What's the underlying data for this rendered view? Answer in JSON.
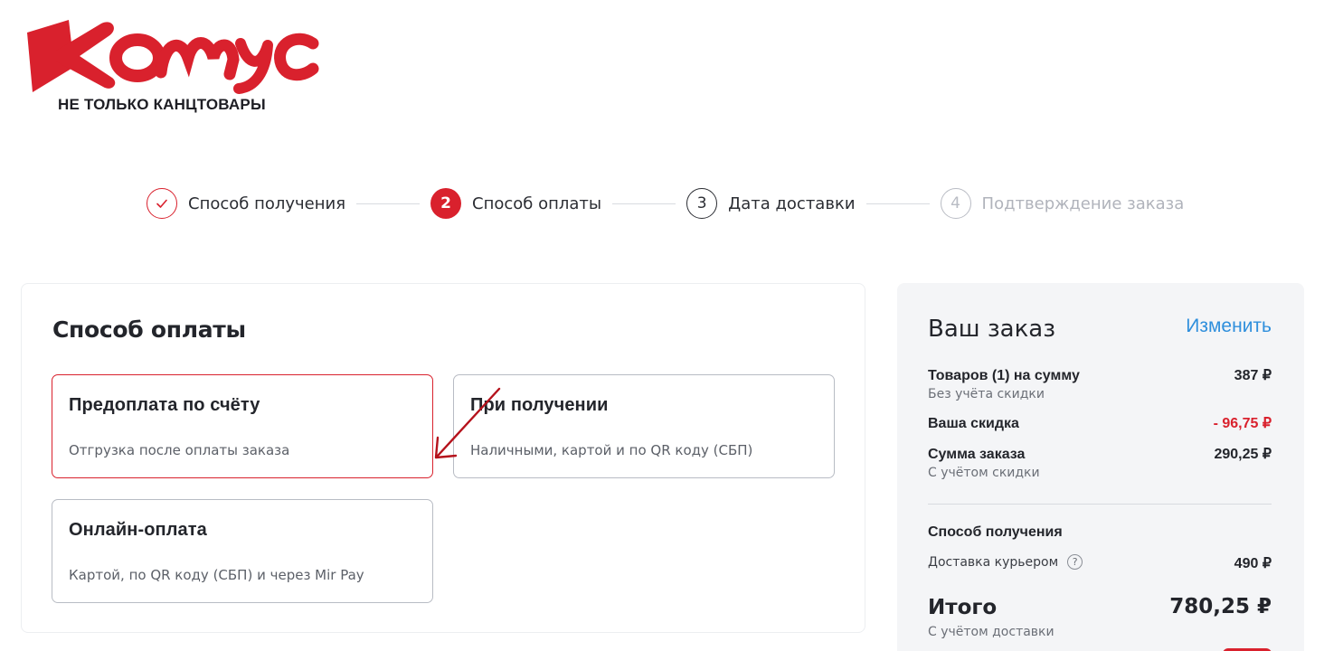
{
  "brand": {
    "logo_text": "Комус",
    "tagline": "НЕ ТОЛЬКО КАНЦТОВАРЫ",
    "color": "#d9212d"
  },
  "stepper": {
    "steps": [
      {
        "number": "",
        "label": "Способ получения",
        "state": "done",
        "icon": "check-icon"
      },
      {
        "number": "2",
        "label": "Способ оплаты",
        "state": "active"
      },
      {
        "number": "3",
        "label": "Дата доставки",
        "state": "todo"
      },
      {
        "number": "4",
        "label": "Подтверждение заказа",
        "state": "disabled"
      }
    ]
  },
  "payment": {
    "title": "Способ оплаты",
    "options": [
      {
        "title": "Предоплата по счёту",
        "subtitle": "Отгрузка после оплаты заказа",
        "selected": true
      },
      {
        "title": "При получении",
        "subtitle": "Наличными, картой и по QR коду (СБП)",
        "selected": false
      },
      {
        "title": "Онлайн-оплата",
        "subtitle": "Картой, по QR коду (СБП) и через Mir Pay",
        "selected": false
      }
    ]
  },
  "order": {
    "title": "Ваш заказ",
    "edit_label": "Изменить",
    "items_label": "Товаров (1) на сумму",
    "items_value": "387 ₽",
    "items_note": "Без учёта скидки",
    "discount_label": "Ваша скидка",
    "discount_value": "- 96,75 ₽",
    "sum_label": "Сумма заказа",
    "sum_value": "290,25 ₽",
    "sum_note": "С учётом скидки",
    "delivery_section": "Способ получения",
    "delivery_label": "Доставка курьером",
    "delivery_help": "?",
    "delivery_value": "490 ₽",
    "total_label": "Итого",
    "total_value": "780,25 ₽",
    "total_note": "С учётом доставки"
  }
}
